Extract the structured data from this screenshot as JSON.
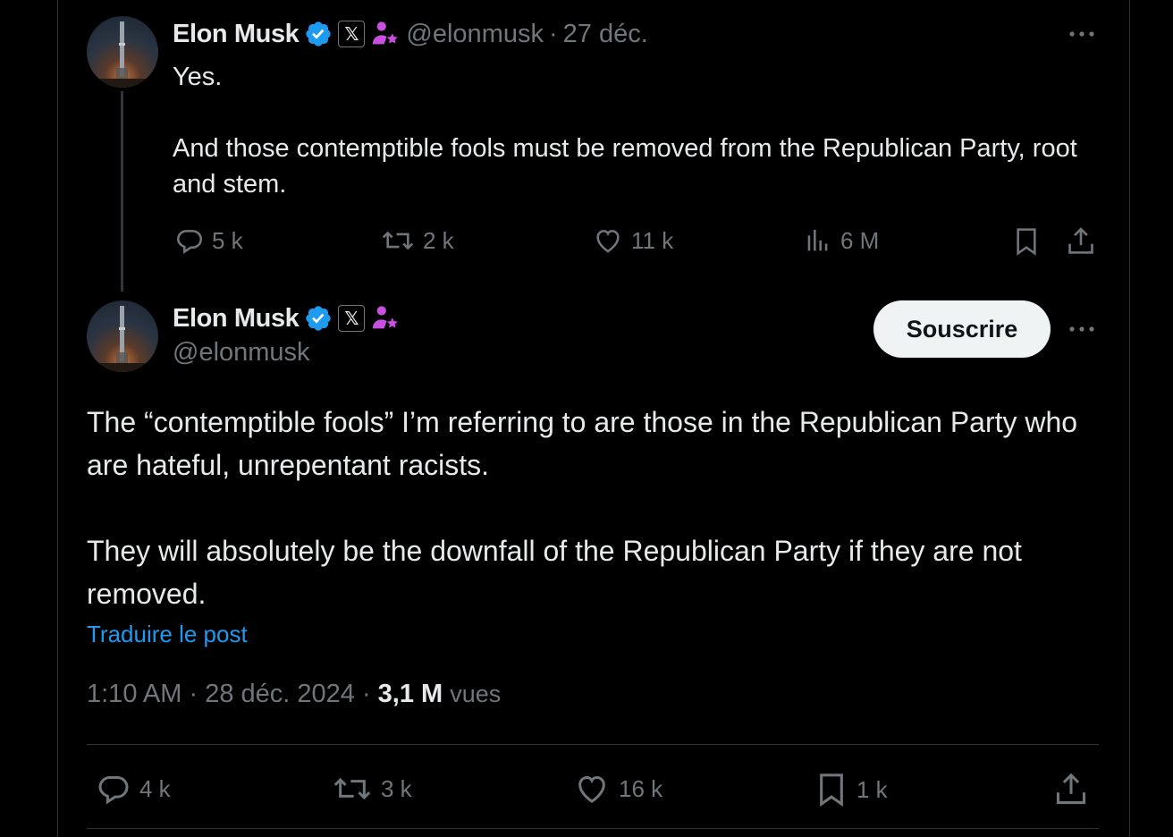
{
  "reply_parent": {
    "author_name": "Elon Musk",
    "x_badge": "𝕏",
    "handle": "@elonmusk",
    "separator": "·",
    "date": "27 déc.",
    "text_line1": "Yes.",
    "text_line2": "And those contemptible fools must be removed from the Republican Party, root and stem.",
    "replies": "5 k",
    "reposts": "2 k",
    "likes": "11 k",
    "views": "6 M"
  },
  "main_post": {
    "author_name": "Elon Musk",
    "x_badge": "𝕏",
    "handle": "@elonmusk",
    "subscribe_label": "Souscrire",
    "paragraph1": "The “contemptible fools” I’m referring to are those in the Republican Party who are hateful, unrepentant racists.",
    "paragraph2": "They will absolutely be the downfall of the Republican Party if they are not removed.",
    "translate_label": "Traduire le post",
    "time": "1:10 AM",
    "date": "28 déc. 2024",
    "sep1": " · ",
    "sep2": " · ",
    "views_count": "3,1 M",
    "views_label": "vues",
    "replies": "4 k",
    "reposts": "3 k",
    "likes": "16 k",
    "bookmarks": "1 k"
  },
  "colors": {
    "background": "#000000",
    "text": "#e7e9ea",
    "muted": "#71767b",
    "link": "#1d9bf0",
    "verified": "#1d9bf0",
    "badge_purple": "#c94fe0"
  }
}
